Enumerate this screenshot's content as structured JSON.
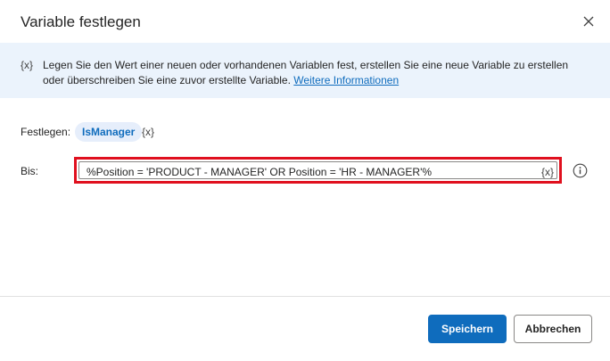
{
  "dialog": {
    "title": "Variable festlegen",
    "close_icon": "close-icon"
  },
  "banner": {
    "icon_text": "{x}",
    "text": "Legen Sie den Wert einer neuen oder vorhandenen Variablen fest, erstellen Sie eine neue Variable zu erstellen oder überschreiben Sie eine zuvor erstellte Variable.",
    "link_text": "Weitere Informationen"
  },
  "form": {
    "set_label": "Festlegen:",
    "variable_name": "IsManager",
    "variable_picker": "{x}",
    "to_label": "Bis:",
    "expression": "%Position = 'PRODUCT - MANAGER' OR Position = 'HR - MANAGER'%",
    "expression_var_picker": "{x}",
    "help_icon": "info-icon"
  },
  "footer": {
    "save_label": "Speichern",
    "cancel_label": "Abbrechen"
  },
  "colors": {
    "accent": "#0f6cbd",
    "banner_bg": "#ebf3fc",
    "highlight": "#e0101e"
  }
}
